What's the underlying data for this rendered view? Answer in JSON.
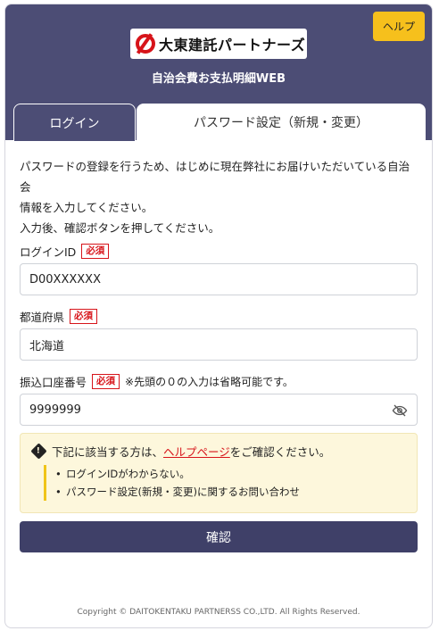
{
  "header": {
    "help_label": "ヘルプ",
    "logo_text": "大東建託パートナーズ",
    "app_title": "自治会費お支払明細WEB"
  },
  "tabs": [
    {
      "label": "ログイン",
      "active": false
    },
    {
      "label": "パスワード設定（新規・変更）",
      "active": true
    }
  ],
  "intro": {
    "line1": "パスワードの登録を行うため、はじめに現在弊社にお届けいただいている自治会",
    "line2": "情報を入力してください。",
    "line3": "入力後、確認ボタンを押してください。"
  },
  "fields": {
    "login_id": {
      "label": "ログインID",
      "required": "必須",
      "value": "D00XXXXXX"
    },
    "prefecture": {
      "label": "都道府県",
      "required": "必須",
      "value": "北海道"
    },
    "account": {
      "label": "振込口座番号",
      "required": "必須",
      "note": "※先頭の０の入力は省略可能です。",
      "value": "9999999"
    }
  },
  "notice": {
    "prefix": "下記に該当する方は、",
    "link": "ヘルプページ",
    "suffix": "をご確認ください。",
    "items": [
      "ログインIDがわからない。",
      "パスワード設定(新規・変更)に関するお問い合わせ"
    ]
  },
  "confirm_label": "確認",
  "footer": "Copyright © DAITOKENTAKU PARTNERSS CO.,LTD. All Rights Reserved.",
  "colors": {
    "header": "#4c4d75",
    "help": "#f6c01c",
    "required": "#d7141a",
    "notice_bg": "#fdf7dc"
  }
}
